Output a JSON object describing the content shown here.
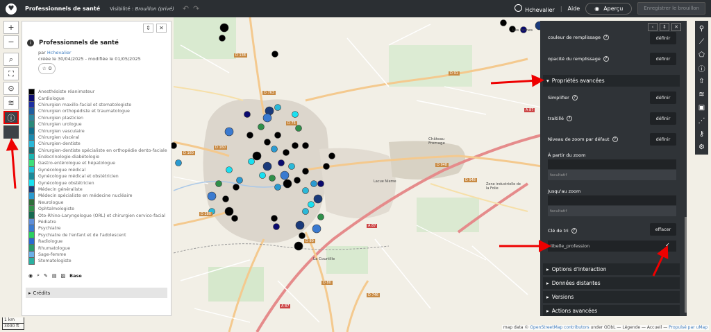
{
  "topbar": {
    "title": "Professionnels de santé",
    "visibility_label": "Visibilité :",
    "visibility_value": "Brouillon (privé)",
    "user": "Hchevalier",
    "help": "Aide",
    "preview": "Aperçu",
    "save": "Enregistrer le brouillon"
  },
  "info_panel": {
    "title": "Professionnels de santé",
    "by_prefix": "par",
    "author": "Hchevalier",
    "dates": "créée le 30/04/2025 - modifiée le 01/05/2025",
    "stars": "0",
    "legend": [
      {
        "label": "Anesthésiste réanimateur",
        "color": "#000000"
      },
      {
        "label": "Cardiologue",
        "color": "#0a0a6e"
      },
      {
        "label": "Chirurgien maxillo-facial et stomatologiste",
        "color": "#1c2fa3"
      },
      {
        "label": "Chirurgien orthopédiste et traumatologue",
        "color": "#1f5ea0"
      },
      {
        "label": "Chirurgien plasticien",
        "color": "#2a87a0"
      },
      {
        "label": "Chirurgien urologue",
        "color": "#2a8a7a"
      },
      {
        "label": "Chirurgien vasculaire",
        "color": "#0f6e8c"
      },
      {
        "label": "Chirurgien viscéral",
        "color": "#1a8ab0"
      },
      {
        "label": "Chirurgien-dentiste",
        "color": "#2ab8d8"
      },
      {
        "label": "Chirurgien-dentiste spécialiste en orthopédie dento-faciale",
        "color": "#1a6e72"
      },
      {
        "label": "Endocrinologie-diabétologie",
        "color": "#1bb5b0"
      },
      {
        "label": "Gastro-entérologue et hépatologue",
        "color": "#3de07a"
      },
      {
        "label": "Gynécologue médical",
        "color": "#20c0d8"
      },
      {
        "label": "Gynécologue médical et obstétricien",
        "color": "#1a8a9a"
      },
      {
        "label": "Gynécologue obstétricien",
        "color": "#19e0f0"
      },
      {
        "label": "Médecin généraliste",
        "color": "#1a3a7a"
      },
      {
        "label": "Médecin spécialiste en médecine nucléaire",
        "color": "#2a9ad0"
      },
      {
        "label": "Neurologue",
        "color": "#2e6e3a"
      },
      {
        "label": "Ophtalmologiste",
        "color": "#2f8f4a"
      },
      {
        "label": "Oto-Rhino-Laryngologue (ORL) et chirurgien cervico-facial",
        "color": "#156a50"
      },
      {
        "label": "Pédiatre",
        "color": "#5e8ed8"
      },
      {
        "label": "Psychiatre",
        "color": "#3a7ad0"
      },
      {
        "label": "Psychiatre de l'enfant et de l'adolescent",
        "color": "#2ad060"
      },
      {
        "label": "Radiologue",
        "color": "#2a6ad0"
      },
      {
        "label": "Rhumatologue",
        "color": "#2a9a6a"
      },
      {
        "label": "Sage-femme",
        "color": "#6ab0e8"
      },
      {
        "label": "Stomatologiste",
        "color": "#2ab0a0"
      }
    ],
    "legend_tools_label": "Base",
    "credits": "Crédits"
  },
  "right_panel": {
    "fill_color_label": "couleur de remplissage",
    "fill_opacity_label": "opacité du remplissage",
    "define": "définir",
    "advanced_props": "Propriétés avancées",
    "simplify": "Simplifier",
    "dashed": "traitillé",
    "default_zoom": "Niveau de zoom par défaut",
    "from_zoom": "À partir du zoom",
    "to_zoom": "Jusqu'au zoom",
    "optional": "facultatif",
    "sort_key": "Clé de tri",
    "clear": "effacer",
    "sort_value": "libelle_profession",
    "sections": [
      "Options d'interaction",
      "Données distantes",
      "Versions",
      "Actions avancées"
    ]
  },
  "map_labels": {
    "roads": [
      "D 763",
      "D 160",
      "D 160",
      "D 138",
      "D 75",
      "D 280",
      "D 80",
      "D 80",
      "D 80",
      "D 948",
      "D 948",
      "D 87",
      "D 748",
      "A 87",
      "A 87",
      "A 87",
      "D 91",
      "D 61",
      "D 746",
      "D 280"
    ],
    "places": [
      "Château Fromage",
      "Zone industrielle de la Folie",
      "La Courtille",
      "Lacue Nieme",
      "Les Fernes"
    ]
  },
  "scale": {
    "km": "1 km",
    "ft": "3000 ft"
  },
  "attribution": {
    "prefix": "map data ©",
    "osm": "OpenStreetMap contributors",
    "rest": "under ODbL — Légende — Accueil —",
    "umap": "Propulsé par uMap"
  },
  "colors": {
    "accent": "#e00000",
    "panel": "#2f3337"
  }
}
